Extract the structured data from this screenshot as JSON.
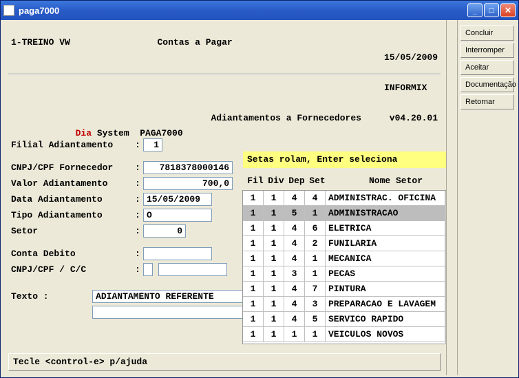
{
  "window": {
    "title": "paga7000"
  },
  "side_buttons": [
    "Concluir",
    "Interromper",
    "Aceitar",
    "Documentação",
    "Retornar"
  ],
  "header": {
    "line1_left": "1-TREINO VW",
    "line1_mid": "Contas a Pagar",
    "line1_date": "15/05/2009",
    "line1_db": "INFORMIX",
    "line2_red": "Dia",
    "line2_rest": " System  PAGA7000",
    "line2_mid": "Adiantamentos a Fornecedores",
    "line2_ver": "v04.20.01"
  },
  "form": {
    "filial_label": "Filial Adiantamento",
    "filial_value": "1",
    "cnpj_forn_label": "CNPJ/CPF Fornecedor",
    "cnpj_forn_value": "7818378000146",
    "valor_label": "Valor Adiantamento ",
    "valor_value": "700,0",
    "data_label": "Data Adiantamento  ",
    "data_value": "15/05/2009",
    "tipo_label": "Tipo Adiantamento  ",
    "tipo_value": "O",
    "setor_label": "Setor              ",
    "setor_value": "0",
    "conta_deb_label": "Conta Debito       ",
    "conta_deb_value": "",
    "cnpj_cc_label": "CNPJ/CPF / C/C     ",
    "cnpj_cc_value1": "",
    "cnpj_cc_value2": "",
    "texto_label": "Texto :",
    "texto_value1": "ADIANTAMENTO REFERENTE",
    "texto_value2": ""
  },
  "popup": {
    "hint": "Setas rolam, Enter seleciona",
    "cols": {
      "fil": "Fil",
      "div": "Div",
      "dep": "Dep",
      "set": "Set",
      "nome": "Nome Setor"
    },
    "rows": [
      {
        "fil": "1",
        "div": "1",
        "dep": "4",
        "set": "4",
        "nome": "ADMINISTRAC. OFICINA",
        "selected": false
      },
      {
        "fil": "1",
        "div": "1",
        "dep": "5",
        "set": "1",
        "nome": "ADMINISTRACAO",
        "selected": true
      },
      {
        "fil": "1",
        "div": "1",
        "dep": "4",
        "set": "6",
        "nome": "ELETRICA",
        "selected": false
      },
      {
        "fil": "1",
        "div": "1",
        "dep": "4",
        "set": "2",
        "nome": "FUNILARIA",
        "selected": false
      },
      {
        "fil": "1",
        "div": "1",
        "dep": "4",
        "set": "1",
        "nome": "MECANICA",
        "selected": false
      },
      {
        "fil": "1",
        "div": "1",
        "dep": "3",
        "set": "1",
        "nome": "PECAS",
        "selected": false
      },
      {
        "fil": "1",
        "div": "1",
        "dep": "4",
        "set": "7",
        "nome": "PINTURA",
        "selected": false
      },
      {
        "fil": "1",
        "div": "1",
        "dep": "4",
        "set": "3",
        "nome": "PREPARACAO E LAVAGEM",
        "selected": false
      },
      {
        "fil": "1",
        "div": "1",
        "dep": "4",
        "set": "5",
        "nome": "SERVICO RAPIDO",
        "selected": false
      },
      {
        "fil": "1",
        "div": "1",
        "dep": "1",
        "set": "1",
        "nome": "VEICULOS NOVOS",
        "selected": false
      }
    ]
  },
  "status": "Tecle <control-e> p/ajuda"
}
